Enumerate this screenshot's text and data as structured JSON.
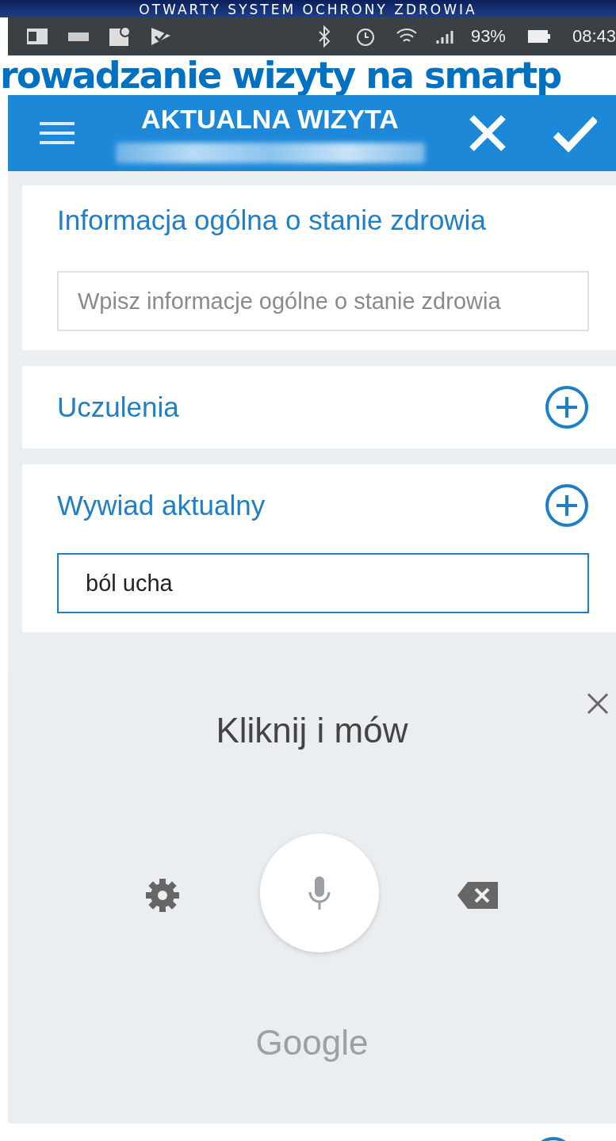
{
  "slide": {
    "banner": "OTWARTY SYSTEM OCHRONY ZDROWIA",
    "title_overlay": "rowadzanie wizyty na smartp"
  },
  "status_bar": {
    "battery": "93%",
    "time": "08:43"
  },
  "app_bar": {
    "title": "AKTUALNA WIZYTA"
  },
  "sections": [
    {
      "title": "Informacja ogólna o stanie zdrowia",
      "kind": "field",
      "placeholder": "Wpisz informacje ogólne o stanie zdrowia"
    },
    {
      "title": "Uczulenia",
      "kind": "add"
    },
    {
      "title": "Wywiad aktualny",
      "kind": "add",
      "value": "ból ucha"
    }
  ],
  "voice_input": {
    "prompt": "Kliknij i mów",
    "brand": "Google"
  }
}
